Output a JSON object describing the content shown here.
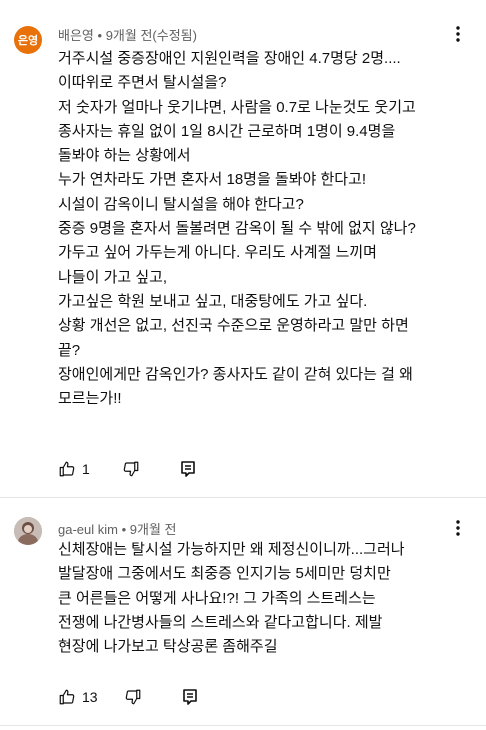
{
  "colors": {
    "avatar1_bg": "#e8710a"
  },
  "comments": [
    {
      "avatar_text": "은영",
      "author": "배은영",
      "separator": "•",
      "time": "9개월 전(수정됨)",
      "lines": [
        "거주시설 중증장애인 지원인력을 장애인 4.7명당 2명....",
        "이따위로 주면서 탈시설을?",
        "저 숫자가 얼마나 웃기냐면, 사람을 0.7로 나눈것도 웃기고",
        "종사자는 휴일 없이 1일 8시간 근로하며 1명이 9.4명을",
        "돌봐야 하는 상황에서",
        "누가 연차라도 가면 혼자서 18명을 돌봐야 한다고!",
        "시설이 감옥이니 탈시설을 해야 한다고?",
        "중증 9명을 혼자서 돌볼려면 감옥이 될 수 밖에 없지 않나?",
        "가두고 싶어 가두는게 아니다. 우리도 사계절 느끼며",
        "나들이 가고 싶고,",
        "가고싶은 학원 보내고 싶고, 대중탕에도 가고 싶다.",
        "상황 개선은 없고, 선진국 수준으로 운영하라고 말만 하면",
        "끝?",
        "장애인에게만 감옥인가? 종사자도 같이 갇혀 있다는 걸 왜",
        "모르는가!!"
      ],
      "likes": "1"
    },
    {
      "author": "ga-eul kim",
      "separator": "•",
      "time": "9개월 전",
      "lines": [
        "신체장애는 탈시설 가능하지만  왜  제정신이니까...그러나",
        "발달장애  그중에서도 최중증  인지기능 5세미만  덩치만",
        "큰 어른들은  어떻게 사나요!?!  그 가족의 스트레스는",
        "전쟁에 나간병사들의  스트레스와  같다고합니다.  제발",
        "현장에 나가보고 탁상공론 좀해주길"
      ],
      "likes": "13"
    }
  ]
}
